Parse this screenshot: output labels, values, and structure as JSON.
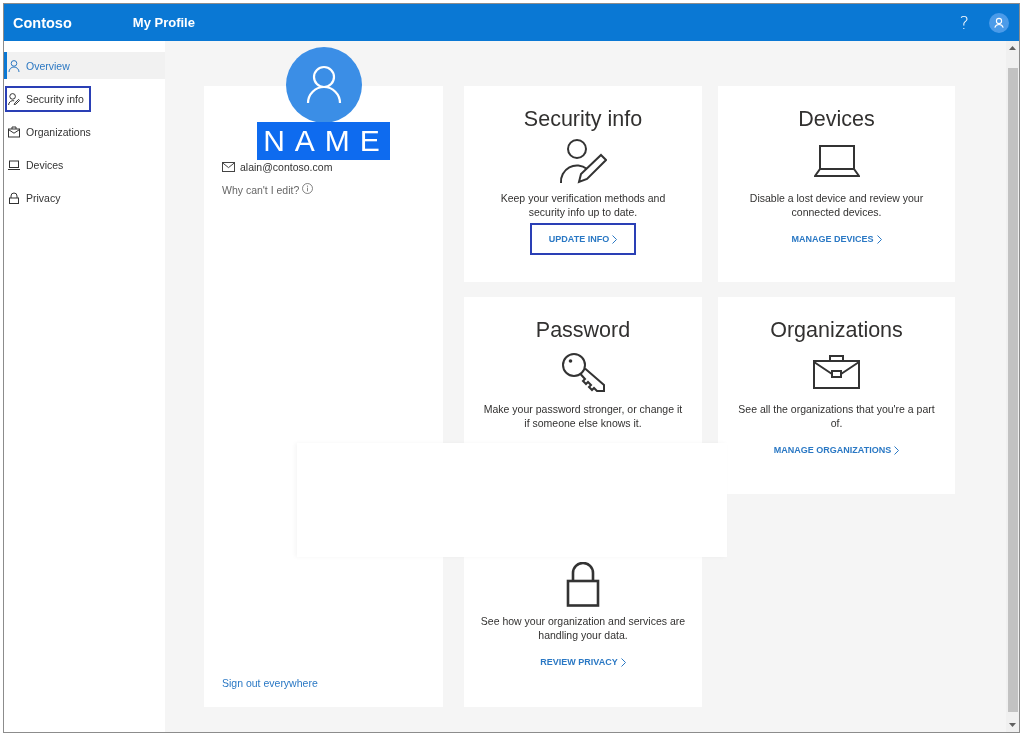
{
  "header": {
    "brand": "Contoso",
    "title": "My Profile",
    "help": "?"
  },
  "sidebar": {
    "items": [
      {
        "kind": "overview",
        "label": "Overview",
        "selected": true,
        "highlighted": false
      },
      {
        "kind": "security",
        "label": "Security info",
        "selected": false,
        "highlighted": true
      },
      {
        "kind": "organizations",
        "label": "Organizations",
        "selected": false,
        "highlighted": false
      },
      {
        "kind": "devices",
        "label": "Devices",
        "selected": false,
        "highlighted": false
      },
      {
        "kind": "privacy",
        "label": "Privacy",
        "selected": false,
        "highlighted": false
      }
    ]
  },
  "profile": {
    "name": "NAME",
    "email": "alain@contoso.com",
    "edit_help": "Why can't I edit?",
    "sign_out": "Sign out everywhere"
  },
  "cards": [
    {
      "kind": "security",
      "title": "Security info",
      "description": "Keep your verification methods and\nsecurity info up to date.",
      "link": {
        "label": "UPDATE INFO",
        "highlighted": true
      }
    },
    {
      "kind": "devices",
      "title": "Devices",
      "description": "Disable a lost device and review your\nconnected devices.",
      "link": {
        "label": "MANAGE DEVICES",
        "highlighted": false
      }
    },
    {
      "kind": "password",
      "title": "Password",
      "description": "Make your password stronger, or change it\nif someone else knows it."
    },
    {
      "kind": "organizations",
      "title": "Organizations",
      "description": "See all the organizations that you're a part\nof.",
      "link": {
        "label": "MANAGE ORGANIZATIONS",
        "highlighted": false
      }
    },
    {
      "kind": "privacy",
      "description": "See how your organization and services are\nhandling your data.",
      "link": {
        "label": "REVIEW PRIVACY",
        "highlighted": false
      }
    }
  ]
}
